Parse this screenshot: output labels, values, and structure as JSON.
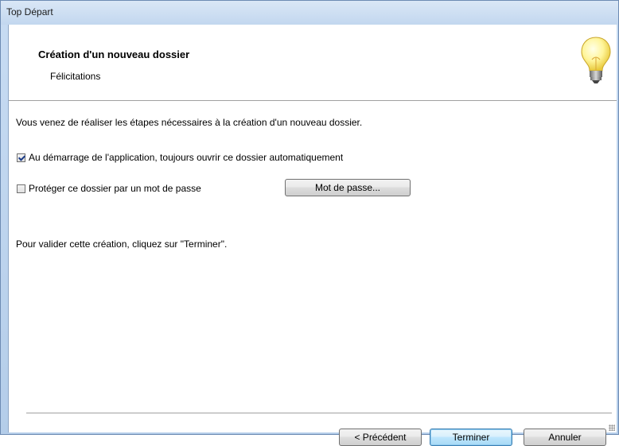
{
  "window": {
    "title": "Top Départ"
  },
  "header": {
    "title": "Création d'un nouveau dossier",
    "subtitle": "Félicitations",
    "icon": "lightbulb-icon"
  },
  "content": {
    "intro": "Vous venez de réaliser les étapes nécessaires à la création d'un nouveau dossier.",
    "auto_open": {
      "label": "Au démarrage de l'application, toujours ouvrir ce dossier automatiquement",
      "checked": true
    },
    "protect": {
      "label": "Protéger ce dossier par un mot de passe",
      "checked": false
    },
    "password_button": "Mot de passe...",
    "validate_text": "Pour valider cette création, cliquez sur \"Terminer\"."
  },
  "footer": {
    "previous_label": "< Précédent",
    "finish_label": "Terminer",
    "cancel_label": "Annuler"
  },
  "colors": {
    "title_bar": "#c8dcf3",
    "default_button_border": "#3c7fb1",
    "check_mark": "#1c3c88"
  }
}
